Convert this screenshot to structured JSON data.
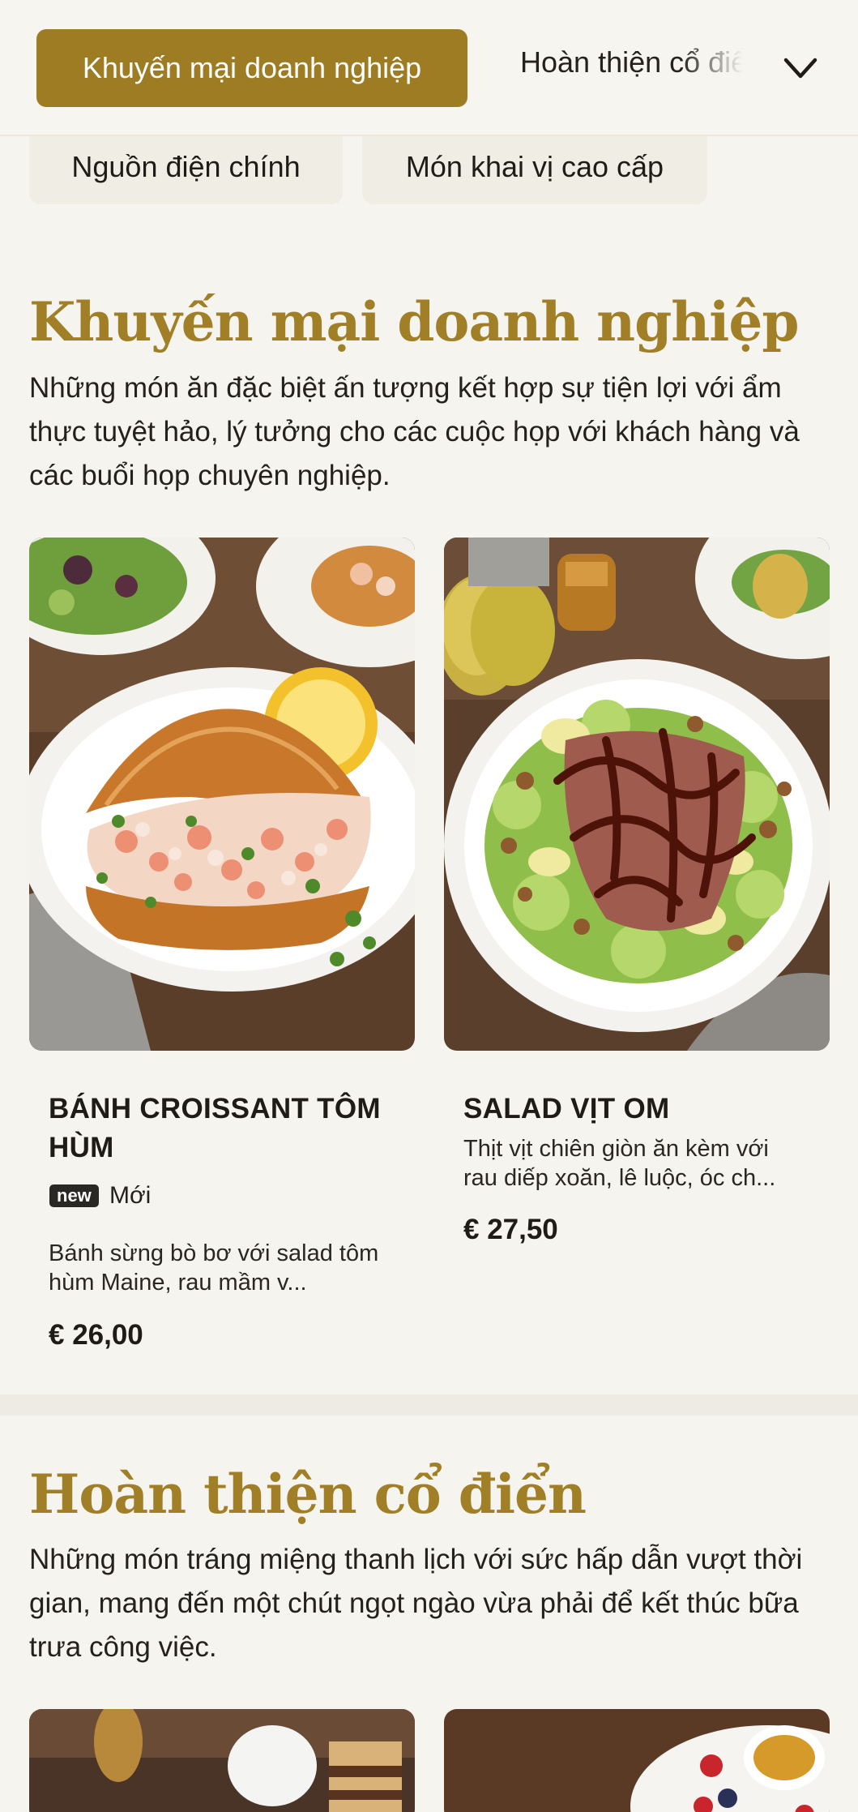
{
  "header": {
    "tabs": [
      {
        "label": "Khuyến mại doanh nghiệp",
        "active": true
      },
      {
        "label": "Hoàn thiện cổ điển",
        "active": false
      }
    ],
    "subtabs": [
      {
        "label": "Nguồn điện chính"
      },
      {
        "label": "Món khai vị cao cấp"
      }
    ],
    "accent_color": "#9d7c24"
  },
  "sections": [
    {
      "title": "Khuyến mại doanh nghiệp",
      "description": "Những món ăn đặc biệt ấn tượng kết hợp sự tiện lợi với ẩm thực tuyệt hảo, lý tưởng cho các cuộc họp với khách hàng và các buổi họp chuyên nghiệp.",
      "items": [
        {
          "name": "BÁNH CROISSANT TÔM HÙM",
          "badge": "new",
          "badge_label": "Mới",
          "description": "Bánh sừng bò bơ với salad tôm hùm Maine, rau mầm v...",
          "price": "€ 26,00"
        },
        {
          "name": "SALAD VỊT OM",
          "description": "Thịt vịt chiên giòn ăn kèm với rau diếp xoăn, lê luộc, óc ch...",
          "price": "€ 27,50"
        }
      ]
    },
    {
      "title": "Hoàn thiện cổ điển",
      "description": "Những món tráng miệng thanh lịch với sức hấp dẫn vượt thời gian, mang đến một chút ngọt ngào vừa phải để kết thúc bữa trưa công việc."
    }
  ]
}
